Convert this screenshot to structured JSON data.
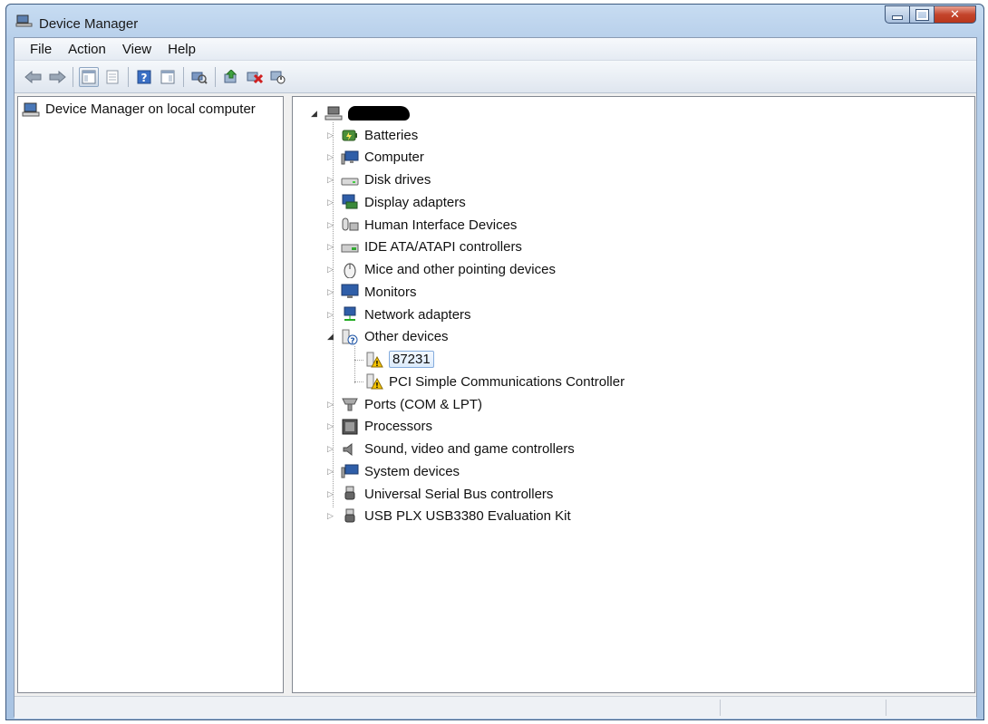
{
  "window": {
    "title": "Device Manager"
  },
  "menu": [
    "File",
    "Action",
    "View",
    "Help"
  ],
  "toolbar": {
    "buttons": [
      "back-arrow-icon",
      "forward-arrow-icon",
      "show-hide-console-tree-icon",
      "properties-icon",
      "help-icon",
      "show-action-pane-icon",
      "scan-hardware-icon",
      "update-driver-icon",
      "uninstall-icon",
      "disable-icon"
    ]
  },
  "left_pane": {
    "root_label": "Device Manager on local computer"
  },
  "tree": {
    "root_name_redacted": true,
    "categories": [
      {
        "label": "Batteries",
        "icon": "battery-icon",
        "expanded": false
      },
      {
        "label": "Computer",
        "icon": "computer-icon",
        "expanded": false
      },
      {
        "label": "Disk drives",
        "icon": "disk-drive-icon",
        "expanded": false
      },
      {
        "label": "Display adapters",
        "icon": "display-adapter-icon",
        "expanded": false
      },
      {
        "label": "Human Interface Devices",
        "icon": "hid-icon",
        "expanded": false
      },
      {
        "label": "IDE ATA/ATAPI controllers",
        "icon": "ide-controller-icon",
        "expanded": false
      },
      {
        "label": "Mice and other pointing devices",
        "icon": "mouse-icon",
        "expanded": false
      },
      {
        "label": "Monitors",
        "icon": "monitor-icon",
        "expanded": false
      },
      {
        "label": "Network adapters",
        "icon": "network-adapter-icon",
        "expanded": false
      },
      {
        "label": "Other devices",
        "icon": "unknown-device-icon",
        "expanded": true,
        "children": [
          {
            "label": "87231",
            "icon": "warning-device-icon",
            "selected": true
          },
          {
            "label": "PCI Simple Communications Controller",
            "icon": "warning-device-icon",
            "selected": false
          }
        ]
      },
      {
        "label": "Ports (COM & LPT)",
        "icon": "port-icon",
        "expanded": false
      },
      {
        "label": "Processors",
        "icon": "processor-icon",
        "expanded": false
      },
      {
        "label": "Sound, video and game controllers",
        "icon": "speaker-icon",
        "expanded": false
      },
      {
        "label": "System devices",
        "icon": "system-device-icon",
        "expanded": false
      },
      {
        "label": "Universal Serial Bus controllers",
        "icon": "usb-icon",
        "expanded": false
      },
      {
        "label": "USB PLX USB3380 Evaluation Kit",
        "icon": "usb-icon",
        "expanded": false
      }
    ]
  },
  "colors": {
    "titlebar": "#b7cfea",
    "selection": "#dcebfc",
    "close_button": "#c4452c"
  }
}
